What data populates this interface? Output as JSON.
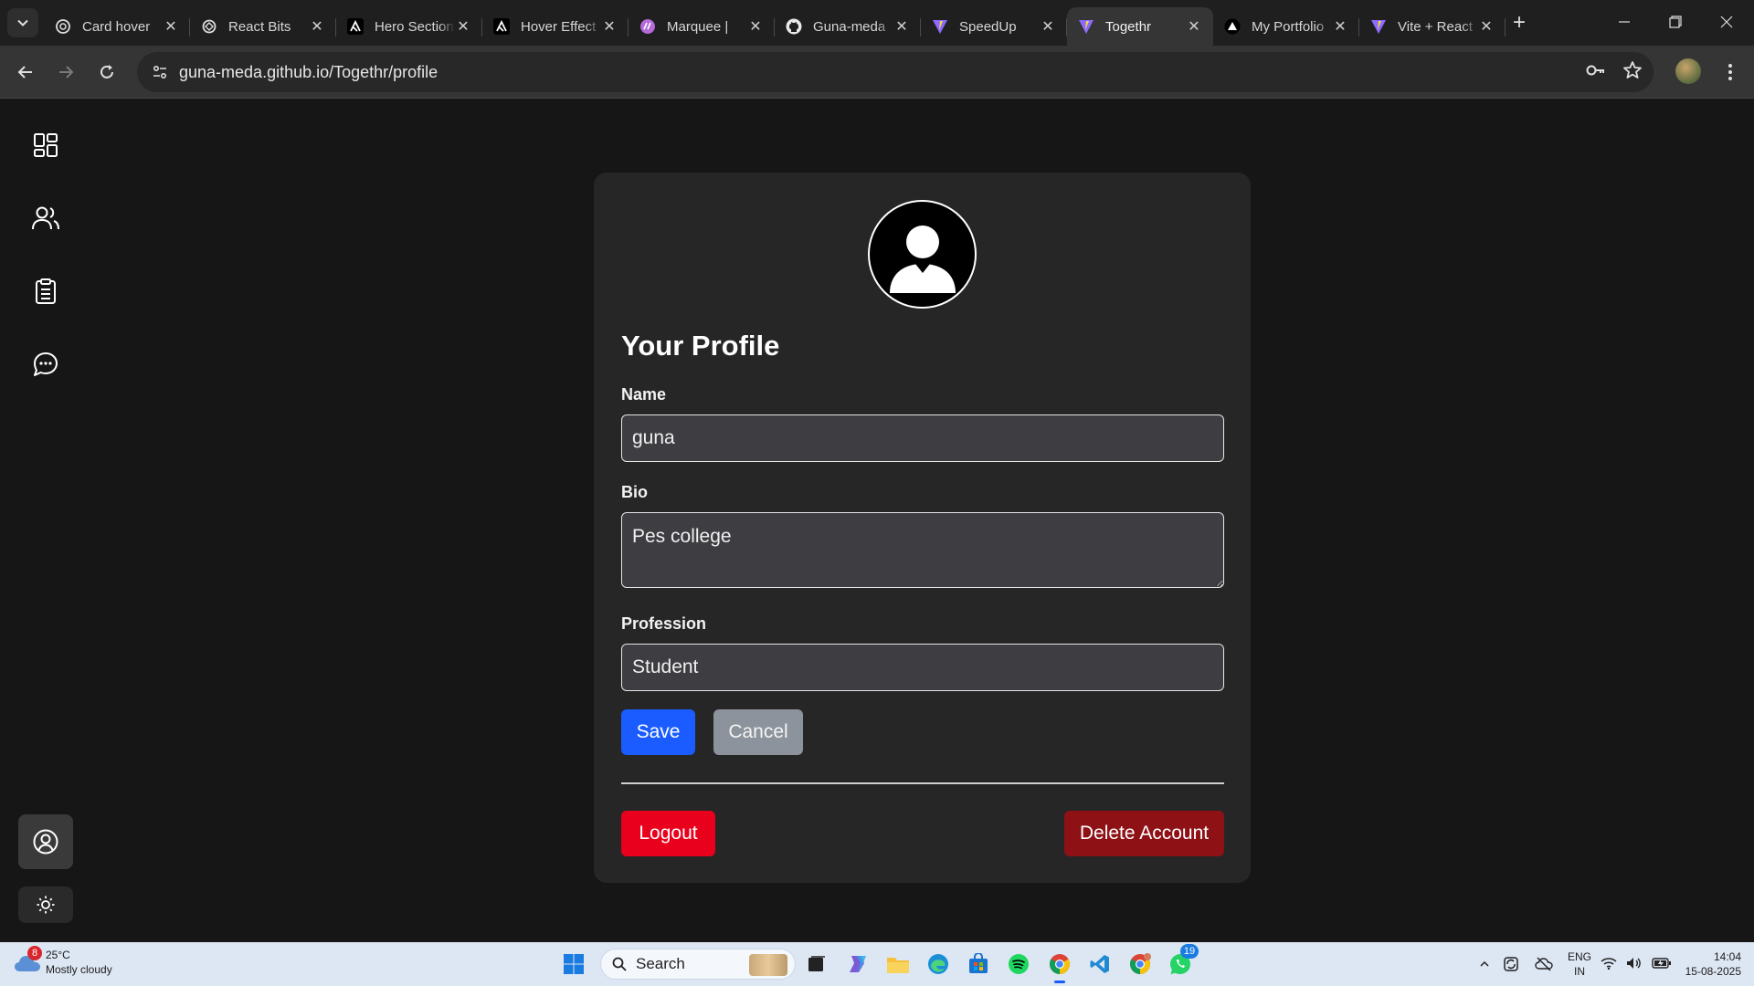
{
  "browser": {
    "tabs": [
      {
        "title": "Card hover",
        "favicon": "openai-icon"
      },
      {
        "title": "React Bits",
        "favicon": "reactbits-icon"
      },
      {
        "title": "Hero Section",
        "favicon": "aceternity-icon"
      },
      {
        "title": "Hover Effect",
        "favicon": "aceternity-icon"
      },
      {
        "title": "Marquee |",
        "favicon": "magicui-icon"
      },
      {
        "title": "Guna-meda",
        "favicon": "github-icon"
      },
      {
        "title": "SpeedUp",
        "favicon": "vite-icon"
      },
      {
        "title": "Togethr",
        "favicon": "vite-icon",
        "active": true
      },
      {
        "title": "My Portfolio",
        "favicon": "vercel-icon"
      },
      {
        "title": "Vite + React",
        "favicon": "vite-icon"
      }
    ],
    "url": "guna-meda.github.io/Togethr/profile"
  },
  "sidebar": {
    "items": [
      {
        "name": "dashboard",
        "icon": "dashboard-icon"
      },
      {
        "name": "people",
        "icon": "users-icon"
      },
      {
        "name": "tasks",
        "icon": "clipboard-icon"
      },
      {
        "name": "chat",
        "icon": "chat-icon"
      }
    ],
    "bottom": [
      {
        "name": "profile",
        "icon": "user-circle-icon"
      },
      {
        "name": "theme",
        "icon": "sun-icon"
      }
    ]
  },
  "profile": {
    "title": "Your Profile",
    "name_label": "Name",
    "name_value": "guna",
    "bio_label": "Bio",
    "bio_value": "Pes college",
    "profession_label": "Profession",
    "profession_value": "Student",
    "save_label": "Save",
    "cancel_label": "Cancel",
    "logout_label": "Logout",
    "delete_label": "Delete Account"
  },
  "taskbar": {
    "weather_temp": "25°C",
    "weather_desc": "Mostly cloudy",
    "weather_badge": "8",
    "search_placeholder": "Search",
    "whatsapp_badge": "19",
    "lang_line1": "ENG",
    "lang_line2": "IN",
    "time": "14:04",
    "date": "15-08-2025"
  },
  "colors": {
    "save": "#1a5cff",
    "cancel": "#8d939c",
    "logout": "#e8001c",
    "delete": "#8e1116",
    "card": "#262626",
    "page": "#161616"
  }
}
